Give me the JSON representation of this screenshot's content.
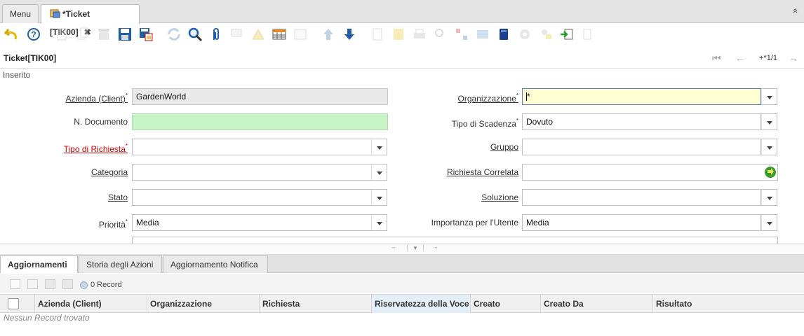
{
  "tabs": {
    "menu": "Menu",
    "active": "*Ticket [TIK00]",
    "close": "✖",
    "collapse": "«"
  },
  "window_title": "Ticket[TIK00]",
  "record_nav": {
    "position": "+*1/1"
  },
  "status_text": "Inserito",
  "form": {
    "azienda": {
      "label": "Azienda (Client)",
      "value": "GardenWorld"
    },
    "organizzazione": {
      "label": "Organizzazione",
      "value": "*"
    },
    "n_documento": {
      "label": "N. Documento",
      "value": ""
    },
    "tipo_scadenza": {
      "label": "Tipo di Scadenza",
      "value": "Dovuto"
    },
    "tipo_richiesta": {
      "label": "Tipo di Richiesta",
      "value": ""
    },
    "gruppo": {
      "label": "Gruppo",
      "value": ""
    },
    "categoria": {
      "label": "Categoria",
      "value": ""
    },
    "richiesta_correlata": {
      "label": "Richiesta Correlata",
      "value": ""
    },
    "stato": {
      "label": "Stato",
      "value": ""
    },
    "soluzione": {
      "label": "Soluzione",
      "value": ""
    },
    "priorita": {
      "label": "Priorità",
      "value": "Media"
    },
    "importanza": {
      "label": "Importanza per l'Utente",
      "value": "Media"
    },
    "required_mark": "*"
  },
  "detail_tabs": [
    "Aggiornamenti",
    "Storia degli Azioni",
    "Aggiornamento Notifica"
  ],
  "grid": {
    "record_count": "0 Record",
    "columns": [
      "Azienda (Client)",
      "Organizzazione",
      "Richiesta",
      "Riservatezza della Voce",
      "Creato",
      "Creato Da",
      "Risultato"
    ],
    "empty_text": "Nessun Record trovato"
  },
  "colors": {
    "accent_blue": "#1f5fa8",
    "mandatory_yellow": "#ffffd2",
    "new_green": "#c8f5c8",
    "required_red": "#cc0000"
  }
}
